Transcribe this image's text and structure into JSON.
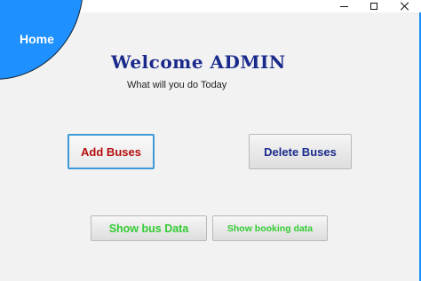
{
  "window": {
    "controls": {
      "minimize_icon": "minimize-icon",
      "maximize_icon": "maximize-icon",
      "close_icon": "close-icon"
    }
  },
  "home": {
    "label": "Home",
    "color": "#1e90ff"
  },
  "header": {
    "title": "Welcome ADMIN",
    "subtitle": "What will you do Today"
  },
  "actions": {
    "add_buses": {
      "label": "Add Buses",
      "color": "#b50d0d"
    },
    "delete_buses": {
      "label": "Delete Buses",
      "color": "#1a2a8c"
    },
    "show_bus_data": {
      "label": "Show bus Data",
      "color": "#33cc33"
    },
    "show_booking_data": {
      "label": "Show booking data",
      "color": "#33cc33"
    }
  }
}
